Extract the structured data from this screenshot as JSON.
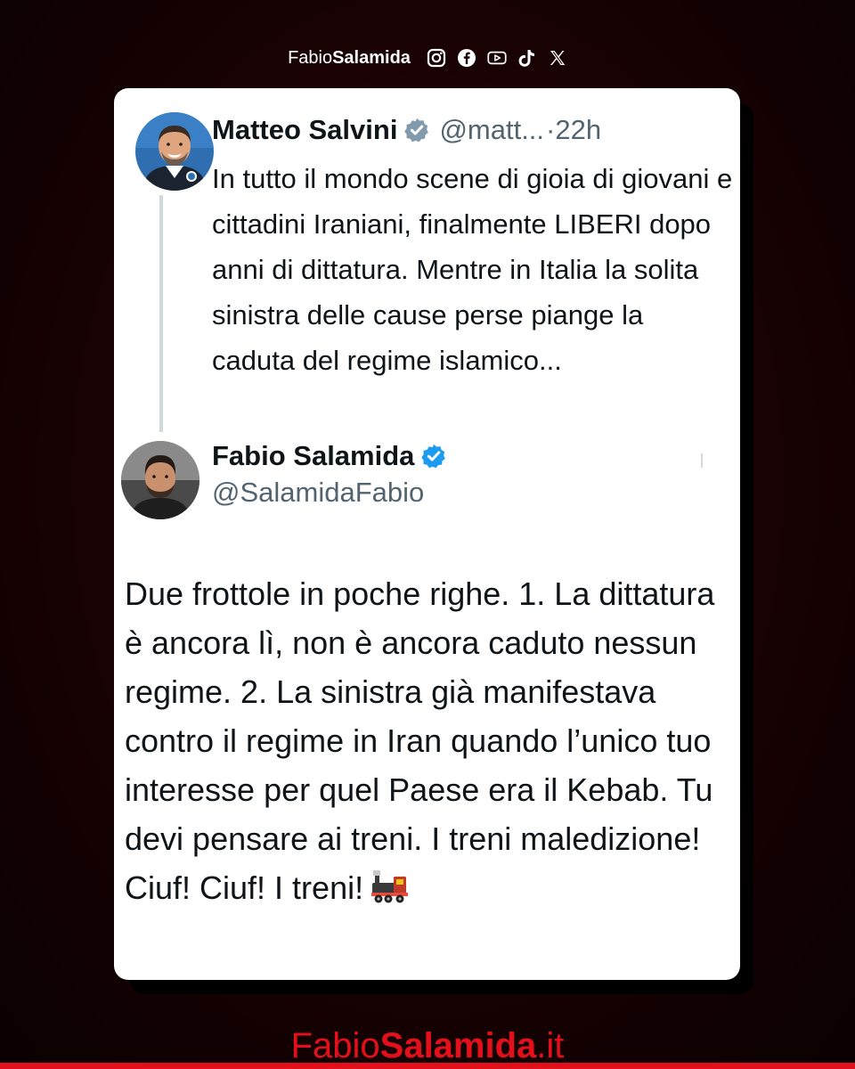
{
  "branding": {
    "top_first": "Fabio",
    "top_last": "Salamida",
    "footer_first": "Fabio",
    "footer_last": "Salamida",
    "footer_tld": ".it",
    "accent_color": "#e3101b",
    "social_icons": [
      "instagram-icon",
      "facebook-icon",
      "youtube-icon",
      "tiktok-icon",
      "x-icon"
    ]
  },
  "tweet_original": {
    "author_name": "Matteo Salvini",
    "handle": "@matt...",
    "separator": "·",
    "time": "22h",
    "verified_color": "#829aab",
    "text": "In tutto il mondo scene di gioia di giovani e cittadini Iraniani, finalmente LIBERI dopo anni di dittatura. Mentre in Italia la solita sinistra delle cause perse piange la caduta del regime islamico..."
  },
  "tweet_reply": {
    "author_name": "Fabio Salamida",
    "handle": "@SalamidaFabio",
    "verified_color": "#1d9bf0",
    "text": "Due frottole in poche righe. 1. La dittatura è ancora lì, non è ancora caduto nessun regime. 2. La sinistra già manifestava contro il regime in Iran quando l’unico tuo interesse per quel Paese era il Kebab. Tu devi pensare ai treni. I treni maledizione! Ciuf! Ciuf! I treni!",
    "emoji": "steam-locomotive-emoji"
  }
}
